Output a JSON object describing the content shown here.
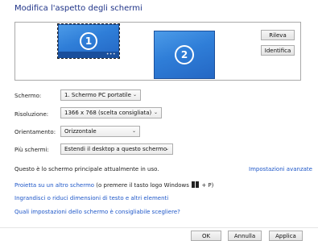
{
  "title": "Modifica l'aspetto degli schermi",
  "monitors": [
    {
      "number": "1",
      "selected": true
    },
    {
      "number": "2",
      "selected": false
    }
  ],
  "buttons": {
    "detect": "Rileva",
    "identify": "Identifica",
    "ok": "OK",
    "cancel": "Annulla",
    "apply": "Applica"
  },
  "settings": {
    "screen": {
      "label": "Schermo:",
      "value": "1. Schermo PC portatile"
    },
    "resolution": {
      "label": "Risoluzione:",
      "value": "1366 x 768 (scelta consigliata)"
    },
    "orientation": {
      "label": "Orientamento:",
      "value": "Orizzontale"
    },
    "multiple": {
      "label": "Più schermi:",
      "value": "Estendi il desktop a questo schermo"
    }
  },
  "primary_text": "Questo è lo schermo principale attualmente in uso.",
  "advanced_link": "Impostazioni avanzate",
  "links": {
    "project_link": "Proietta su un altro schermo",
    "project_hint_pre": " (o premere il tasto logo Windows ",
    "project_hint_post": " + P)",
    "text_size": "Ingrandisci o riduci dimensioni di testo e altri elementi",
    "which_settings": "Quali impostazioni dello schermo è consigliabile scegliere?"
  },
  "colors": {
    "title": "#1e3287",
    "link": "#1e57c8",
    "monitor": "#2f7ed8"
  }
}
